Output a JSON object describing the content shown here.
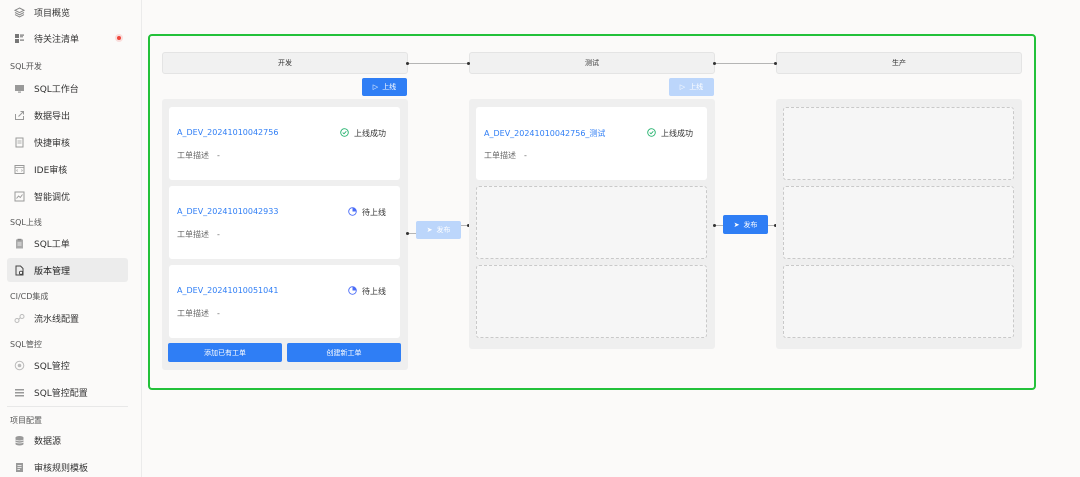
{
  "sidebar": {
    "items_top": [
      {
        "label": "项目概览",
        "icon": "layers-icon"
      },
      {
        "label": "待关注清单",
        "icon": "list-icon"
      }
    ],
    "groups": [
      {
        "title": "SQL开发",
        "items": [
          {
            "label": "SQL工作台",
            "icon": "monitor-icon"
          },
          {
            "label": "数据导出",
            "icon": "export-icon"
          },
          {
            "label": "快捷审核",
            "icon": "document-icon"
          },
          {
            "label": "IDE审核",
            "icon": "code-icon"
          },
          {
            "label": "智能调优",
            "icon": "chart-icon"
          }
        ]
      },
      {
        "title": "SQL上线",
        "items": [
          {
            "label": "SQL工单",
            "icon": "clipboard-icon"
          },
          {
            "label": "版本管理",
            "icon": "file-settings-icon"
          }
        ]
      },
      {
        "title": "CI/CD集成",
        "items": [
          {
            "label": "流水线配置",
            "icon": "pipeline-icon"
          }
        ]
      },
      {
        "title": "SQL管控",
        "items": [
          {
            "label": "SQL管控",
            "icon": "shield-icon"
          },
          {
            "label": "SQL管控配置",
            "icon": "config-list-icon"
          }
        ]
      },
      {
        "title": "项目配置",
        "items": [
          {
            "label": "数据源",
            "icon": "database-icon"
          },
          {
            "label": "审核规则模板",
            "icon": "template-icon"
          }
        ]
      }
    ]
  },
  "stages": [
    {
      "title": "开发"
    },
    {
      "title": "测试"
    },
    {
      "title": "生产"
    }
  ],
  "buttons": {
    "online": "上线",
    "publish": "发布",
    "add_existing": "添加已有工单",
    "create_new": "创建新工单"
  },
  "dev_cards": [
    {
      "name": "A_DEV_20241010042756",
      "status": "上线成功",
      "desc_label": "工单描述",
      "desc_value": "-"
    },
    {
      "name": "A_DEV_20241010042933",
      "status": "待上线",
      "desc_label": "工单描述",
      "desc_value": "-"
    },
    {
      "name": "A_DEV_20241010051041",
      "status": "待上线",
      "desc_label": "工单描述",
      "desc_value": "-"
    }
  ],
  "test_cards": [
    {
      "name": "A_DEV_20241010042756_测试",
      "status": "上线成功",
      "desc_label": "工单描述",
      "desc_value": "-"
    }
  ],
  "colors": {
    "accent": "#2f7ef5",
    "success": "#23b26d",
    "pending": "#4a6cf7",
    "frame": "#23c13a"
  }
}
